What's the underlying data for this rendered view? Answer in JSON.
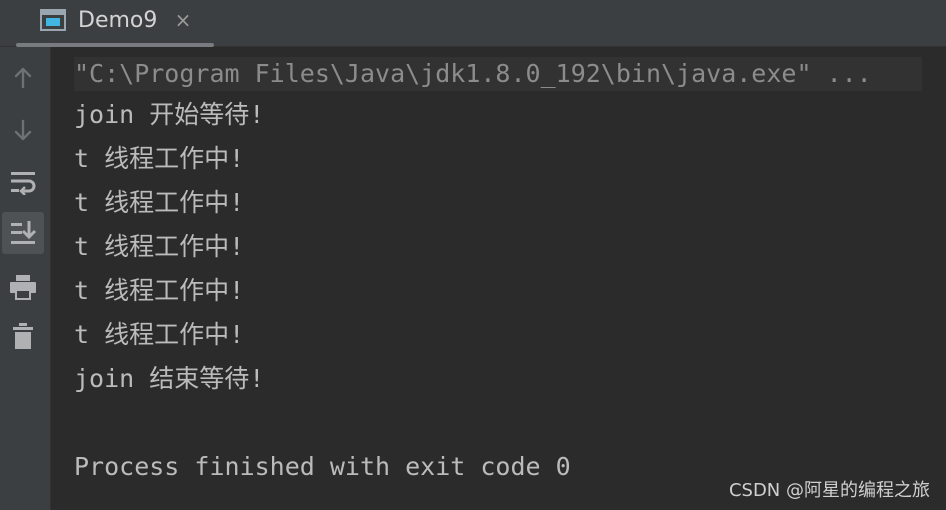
{
  "tab": {
    "label": "Demo9",
    "close_glyph": "×",
    "icon": "run-console-icon"
  },
  "toolbar": {
    "items": [
      {
        "name": "up-arrow-icon",
        "label": "Up"
      },
      {
        "name": "down-arrow-icon",
        "label": "Down"
      },
      {
        "name": "soft-wrap-icon",
        "label": "Soft-wrap"
      },
      {
        "name": "scroll-to-end-icon",
        "label": "Scroll to end",
        "selected": true
      },
      {
        "name": "print-icon",
        "label": "Print"
      },
      {
        "name": "trash-icon",
        "label": "Clear All"
      }
    ]
  },
  "console": {
    "command": "\"C:\\Program Files\\Java\\jdk1.8.0_192\\bin\\java.exe\" ...",
    "lines": [
      "join 开始等待!",
      "t 线程工作中!",
      "t 线程工作中!",
      "t 线程工作中!",
      "t 线程工作中!",
      "t 线程工作中!",
      "join 结束等待!",
      "",
      "Process finished with exit code 0"
    ]
  },
  "watermark": "CSDN @阿星的编程之旅",
  "colors": {
    "background": "#2b2b2b",
    "panel": "#3c3f41",
    "text": "#bbbbbb",
    "command_text": "#8c8c8c"
  }
}
